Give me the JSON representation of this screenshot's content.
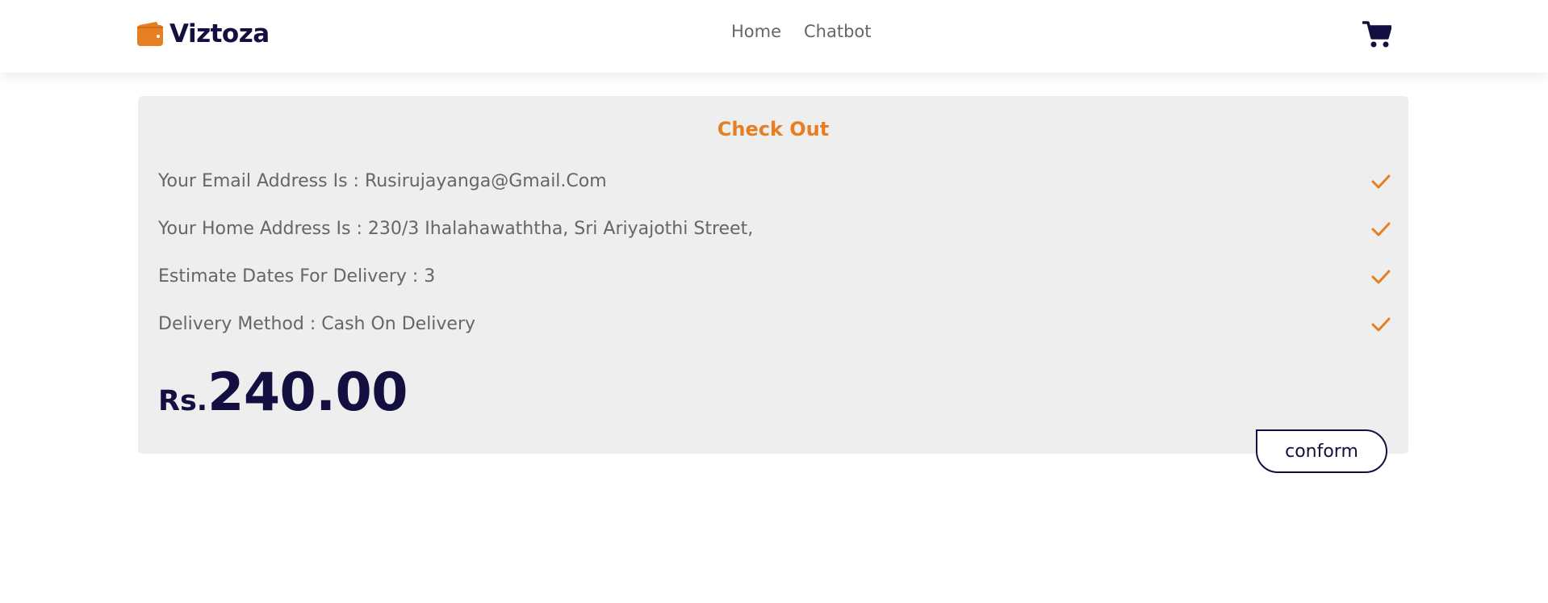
{
  "header": {
    "brand": {
      "icon": "wallet-icon",
      "name": "Viztoza",
      "color": "#130f40",
      "icon_color": "#e67e22"
    },
    "nav": [
      {
        "label": "Home"
      },
      {
        "label": "Chatbot"
      }
    ],
    "cart_icon": "shopping-cart-icon"
  },
  "checkout": {
    "title": "Check Out",
    "accent_color": "#e67e22",
    "rows": [
      {
        "text": "Your Email Address Is : Rusirujayanga@Gmail.Com",
        "icon": "check-icon"
      },
      {
        "text": "Your Home Address Is : 230/3 Ihalahawaththa, Sri Ariyajothi Street,",
        "icon": "check-icon"
      },
      {
        "text": "Estimate Dates For Delivery : 3",
        "icon": "check-icon"
      },
      {
        "text": "Delivery Method : Cash On Delivery",
        "icon": "check-icon"
      }
    ],
    "price": {
      "currency": "Rs.",
      "amount": "240.00"
    },
    "confirm_label": "conform"
  }
}
